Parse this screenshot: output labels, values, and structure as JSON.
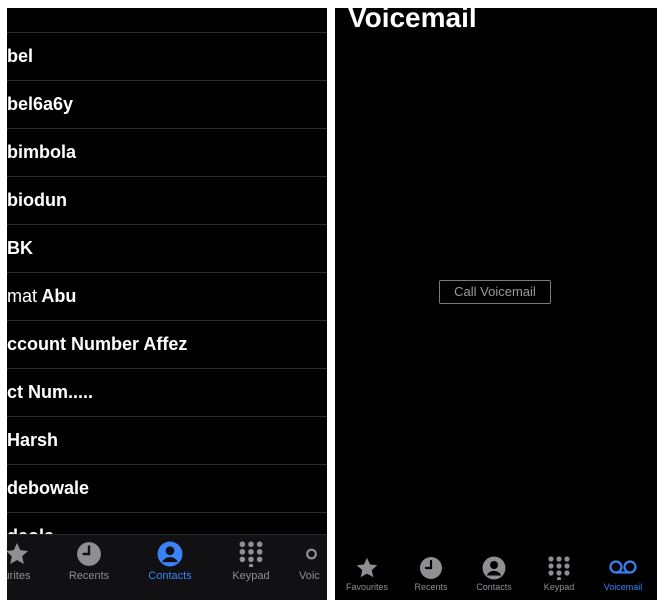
{
  "contacts_screen": {
    "rows": [
      {
        "text": "bel"
      },
      {
        "text": "bel6a6y"
      },
      {
        "text": "bimbola"
      },
      {
        "text": "biodun"
      },
      {
        "text": "BK"
      },
      {
        "text": "mat",
        "bold_text": "Abu"
      },
      {
        "text": "ccount Number Affez"
      },
      {
        "text": "ct Num....."
      },
      {
        "text": "Harsh"
      },
      {
        "text": "debowale"
      },
      {
        "text": "deola"
      }
    ],
    "tabbar": {
      "favourites": "urites",
      "recents": "Recents",
      "contacts": "Contacts",
      "keypad": "Keypad",
      "voicemail": "Voic"
    }
  },
  "voicemail_screen": {
    "title": "Voicemail",
    "call_button": "Call Voicemail",
    "tabbar": {
      "favourites": "Favourites",
      "recents": "Recents",
      "contacts": "Contacts",
      "keypad": "Keypad",
      "voicemail": "Voicemail"
    }
  },
  "colors": {
    "accent": "#3a82f7",
    "inactive": "#8e8e93",
    "background": "#000000"
  },
  "icons": [
    "star-icon",
    "clock-icon",
    "person-icon",
    "keypad-icon",
    "voicemail-icon"
  ]
}
